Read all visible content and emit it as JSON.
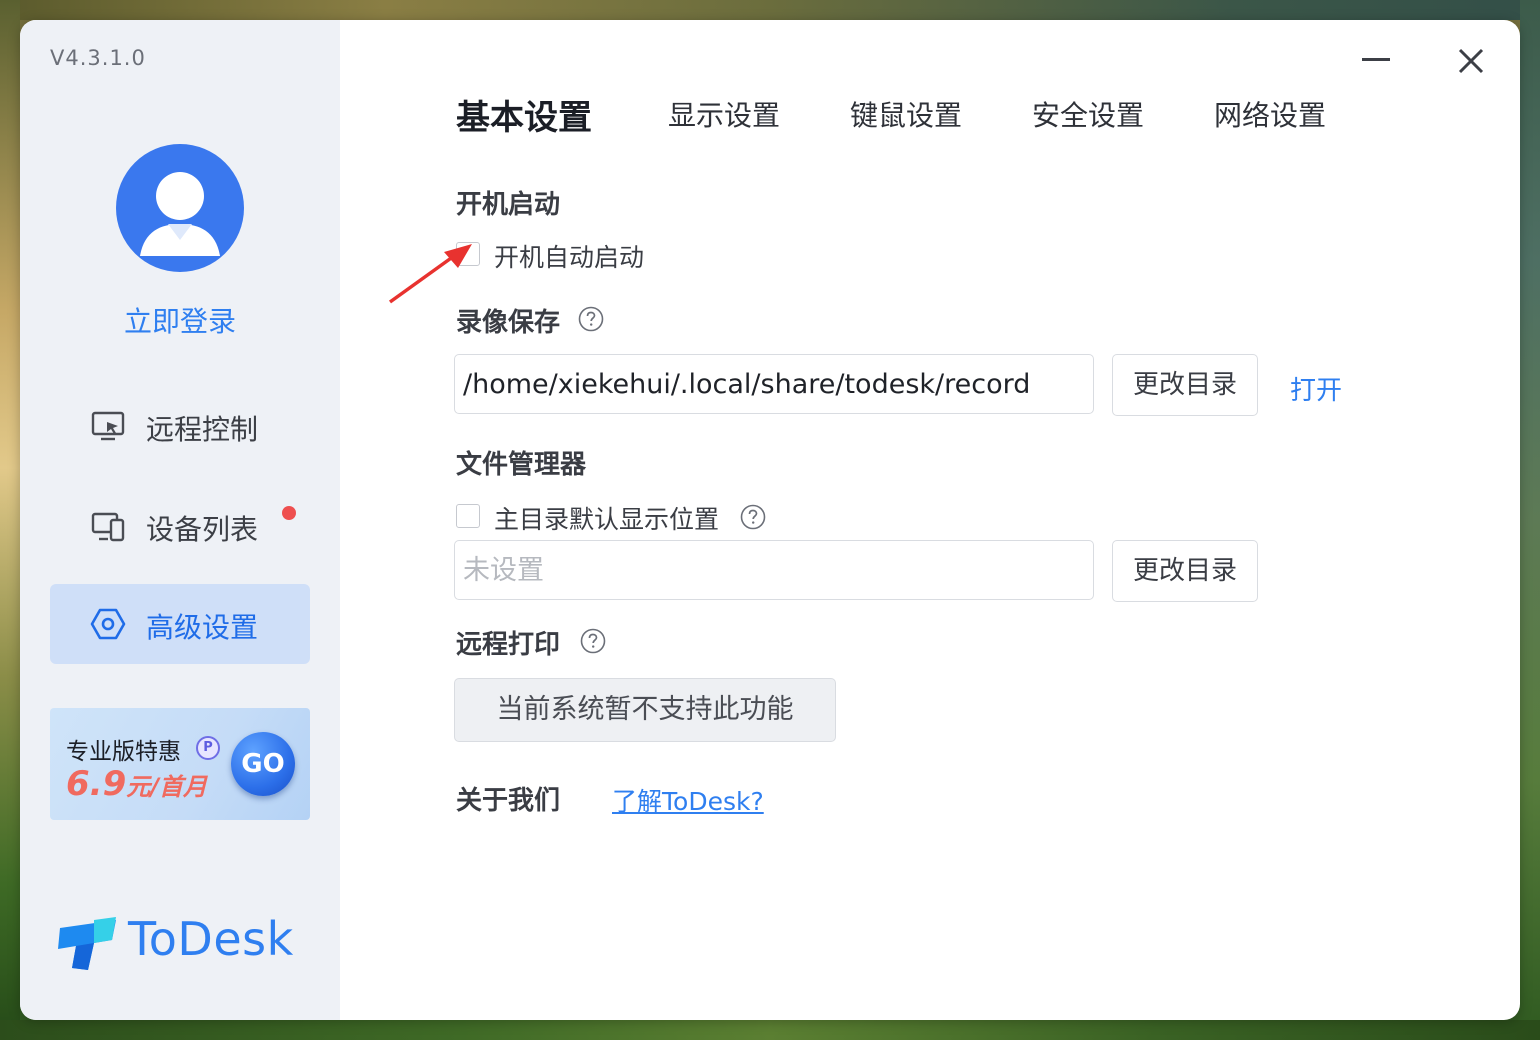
{
  "window": {
    "version": "V4.3.1.0"
  },
  "sidebar": {
    "login_label": "立即登录",
    "items": [
      {
        "label": "远程控制",
        "icon": "monitor-remote-icon"
      },
      {
        "label": "设备列表",
        "icon": "devices-icon",
        "badge_dot": true
      },
      {
        "label": "高级设置",
        "icon": "hexagon-settings-icon",
        "active": true
      }
    ],
    "promo": {
      "title": "专业版特惠",
      "badge": "P",
      "price_num": "6.9",
      "price_unit": "元/首月",
      "go_label": "GO"
    },
    "brand": "ToDesk"
  },
  "tabs": [
    {
      "label": "基本设置",
      "active": true
    },
    {
      "label": "显示设置"
    },
    {
      "label": "键鼠设置"
    },
    {
      "label": "安全设置"
    },
    {
      "label": "网络设置"
    }
  ],
  "startup": {
    "title": "开机启动",
    "checkbox_label": "开机自动启动",
    "checked": false
  },
  "recording": {
    "title": "录像保存",
    "path": "/home/xiekehui/.local/share/todesk/record",
    "change_label": "更改目录",
    "open_label": "打开"
  },
  "file_manager": {
    "title": "文件管理器",
    "checkbox_label": "主目录默认显示位置",
    "checked": false,
    "placeholder": "未设置",
    "change_label": "更改目录"
  },
  "remote_print": {
    "title": "远程打印",
    "unsupported_label": "当前系统暂不支持此功能"
  },
  "about": {
    "title": "关于我们",
    "link": "了解ToDesk? "
  },
  "colors": {
    "accent": "#2f7ff0",
    "sidebar_bg": "#eef1f6",
    "active_bg": "#cfdff8",
    "badge_red": "#ee4f4f",
    "annotation_arrow": "#e8322f"
  }
}
